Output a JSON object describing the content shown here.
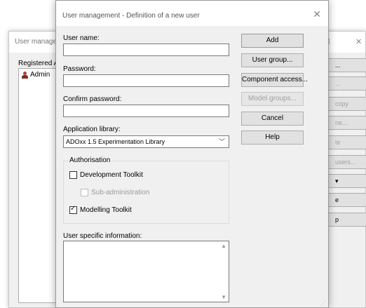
{
  "background_window": {
    "title": "User manage",
    "registered_label": "Registered A",
    "list_items": [
      {
        "label": "Admin"
      }
    ],
    "buttons": [
      "...",
      "...",
      "copy",
      "ne...",
      "te",
      "users...",
      "▾",
      "e",
      "p"
    ]
  },
  "dialog": {
    "title": "User management - Definition of a new user",
    "username_label": "User name:",
    "password_label": "Password:",
    "confirm_password_label": "Confirm password:",
    "app_library_label": "Application library:",
    "app_library_value": "ADOxx 1.5 Experimentation Library",
    "authorisation_label": "Authorisation",
    "dev_toolkit_label": "Development Toolkit",
    "sub_admin_label": "Sub-administration",
    "modelling_toolkit_label": "Modelling Toolkit",
    "user_info_label": "User specific information:",
    "buttons": {
      "add": "Add",
      "user_group": "User group...",
      "component_access": "Component access...",
      "model_groups": "Model groups...",
      "cancel": "Cancel",
      "help": "Help"
    }
  }
}
